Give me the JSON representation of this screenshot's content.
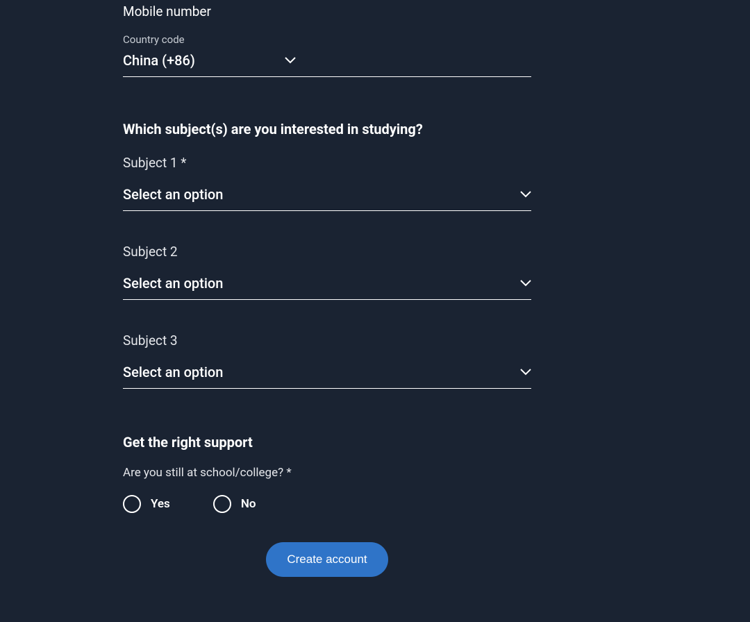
{
  "mobile": {
    "heading": "Mobile number",
    "country_code_label": "Country code",
    "country_code_value": "China (+86)"
  },
  "subjects": {
    "heading": "Which subject(s) are you interested in studying?",
    "items": [
      {
        "label": "Subject 1 *",
        "value": "Select an option"
      },
      {
        "label": "Subject 2",
        "value": "Select an option"
      },
      {
        "label": "Subject 3",
        "value": "Select an option"
      }
    ]
  },
  "support": {
    "heading": "Get the right support",
    "question": "Are you still at school/college? *",
    "options": [
      {
        "label": "Yes"
      },
      {
        "label": "No"
      }
    ]
  },
  "button_label": "Create account"
}
